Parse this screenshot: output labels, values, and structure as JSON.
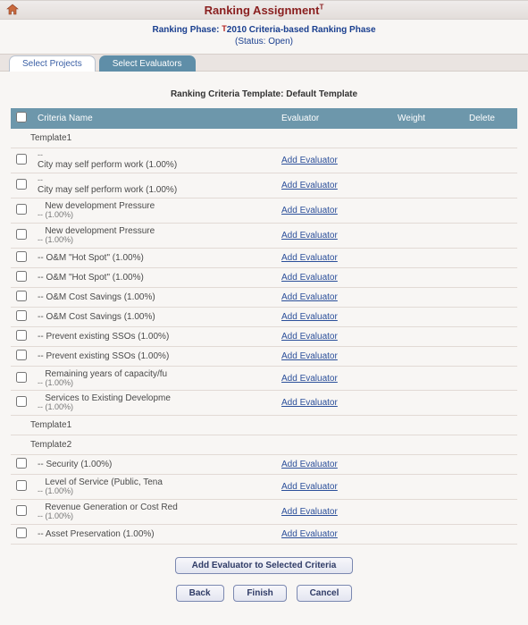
{
  "header": {
    "title": "Ranking Assignment",
    "title_sup": "T"
  },
  "phase": {
    "label": "Ranking Phase:",
    "marker": "T",
    "name": "2010 Criteria-based Ranking Phase",
    "status": "(Status: Open)"
  },
  "tabs": {
    "select_projects": "Select Projects",
    "select_evaluators": "Select Evaluators"
  },
  "template_title": "Ranking Criteria Template: Default Template",
  "columns": {
    "criteria": "Criteria Name",
    "evaluator": "Evaluator",
    "weight": "Weight",
    "delete": "Delete"
  },
  "add_evaluator_label": "Add Evaluator",
  "rows": [
    {
      "type": "section",
      "label": "Template1"
    },
    {
      "type": "item",
      "primary": "City may self perform work (1.00%)",
      "secondary": "--"
    },
    {
      "type": "item",
      "primary": "City may self perform work (1.00%)",
      "secondary": "--"
    },
    {
      "type": "item",
      "primary": "New development Pressure",
      "secondary": "-- (1.00%)",
      "indented": true
    },
    {
      "type": "item",
      "primary": "New development Pressure",
      "secondary": "-- (1.00%)",
      "indented": true
    },
    {
      "type": "item",
      "primary": "-- O&M \"Hot Spot\" (1.00%)"
    },
    {
      "type": "item",
      "primary": "-- O&M \"Hot Spot\" (1.00%)"
    },
    {
      "type": "item",
      "primary": "-- O&M Cost Savings (1.00%)"
    },
    {
      "type": "item",
      "primary": "-- O&M Cost Savings (1.00%)"
    },
    {
      "type": "item",
      "primary": "-- Prevent existing SSOs (1.00%)"
    },
    {
      "type": "item",
      "primary": "-- Prevent existing SSOs (1.00%)"
    },
    {
      "type": "item",
      "primary": "Remaining years of capacity/fu",
      "secondary": "-- (1.00%)",
      "indented": true
    },
    {
      "type": "item",
      "primary": "Services to Existing Developme",
      "secondary": "-- (1.00%)",
      "indented": true
    },
    {
      "type": "section",
      "label": "Template1"
    },
    {
      "type": "section",
      "label": "Template2"
    },
    {
      "type": "item",
      "primary": "-- Security (1.00%)"
    },
    {
      "type": "item",
      "primary": "Level of Service (Public, Tena",
      "secondary": "-- (1.00%)",
      "indented": true
    },
    {
      "type": "item",
      "primary": "Revenue Generation or Cost Red",
      "secondary": "-- (1.00%)",
      "indented": true
    },
    {
      "type": "item",
      "primary": "-- Asset Preservation (1.00%)"
    }
  ],
  "buttons": {
    "add_to_selected": "Add Evaluator to Selected Criteria",
    "back": "Back",
    "finish": "Finish",
    "cancel": "Cancel"
  }
}
